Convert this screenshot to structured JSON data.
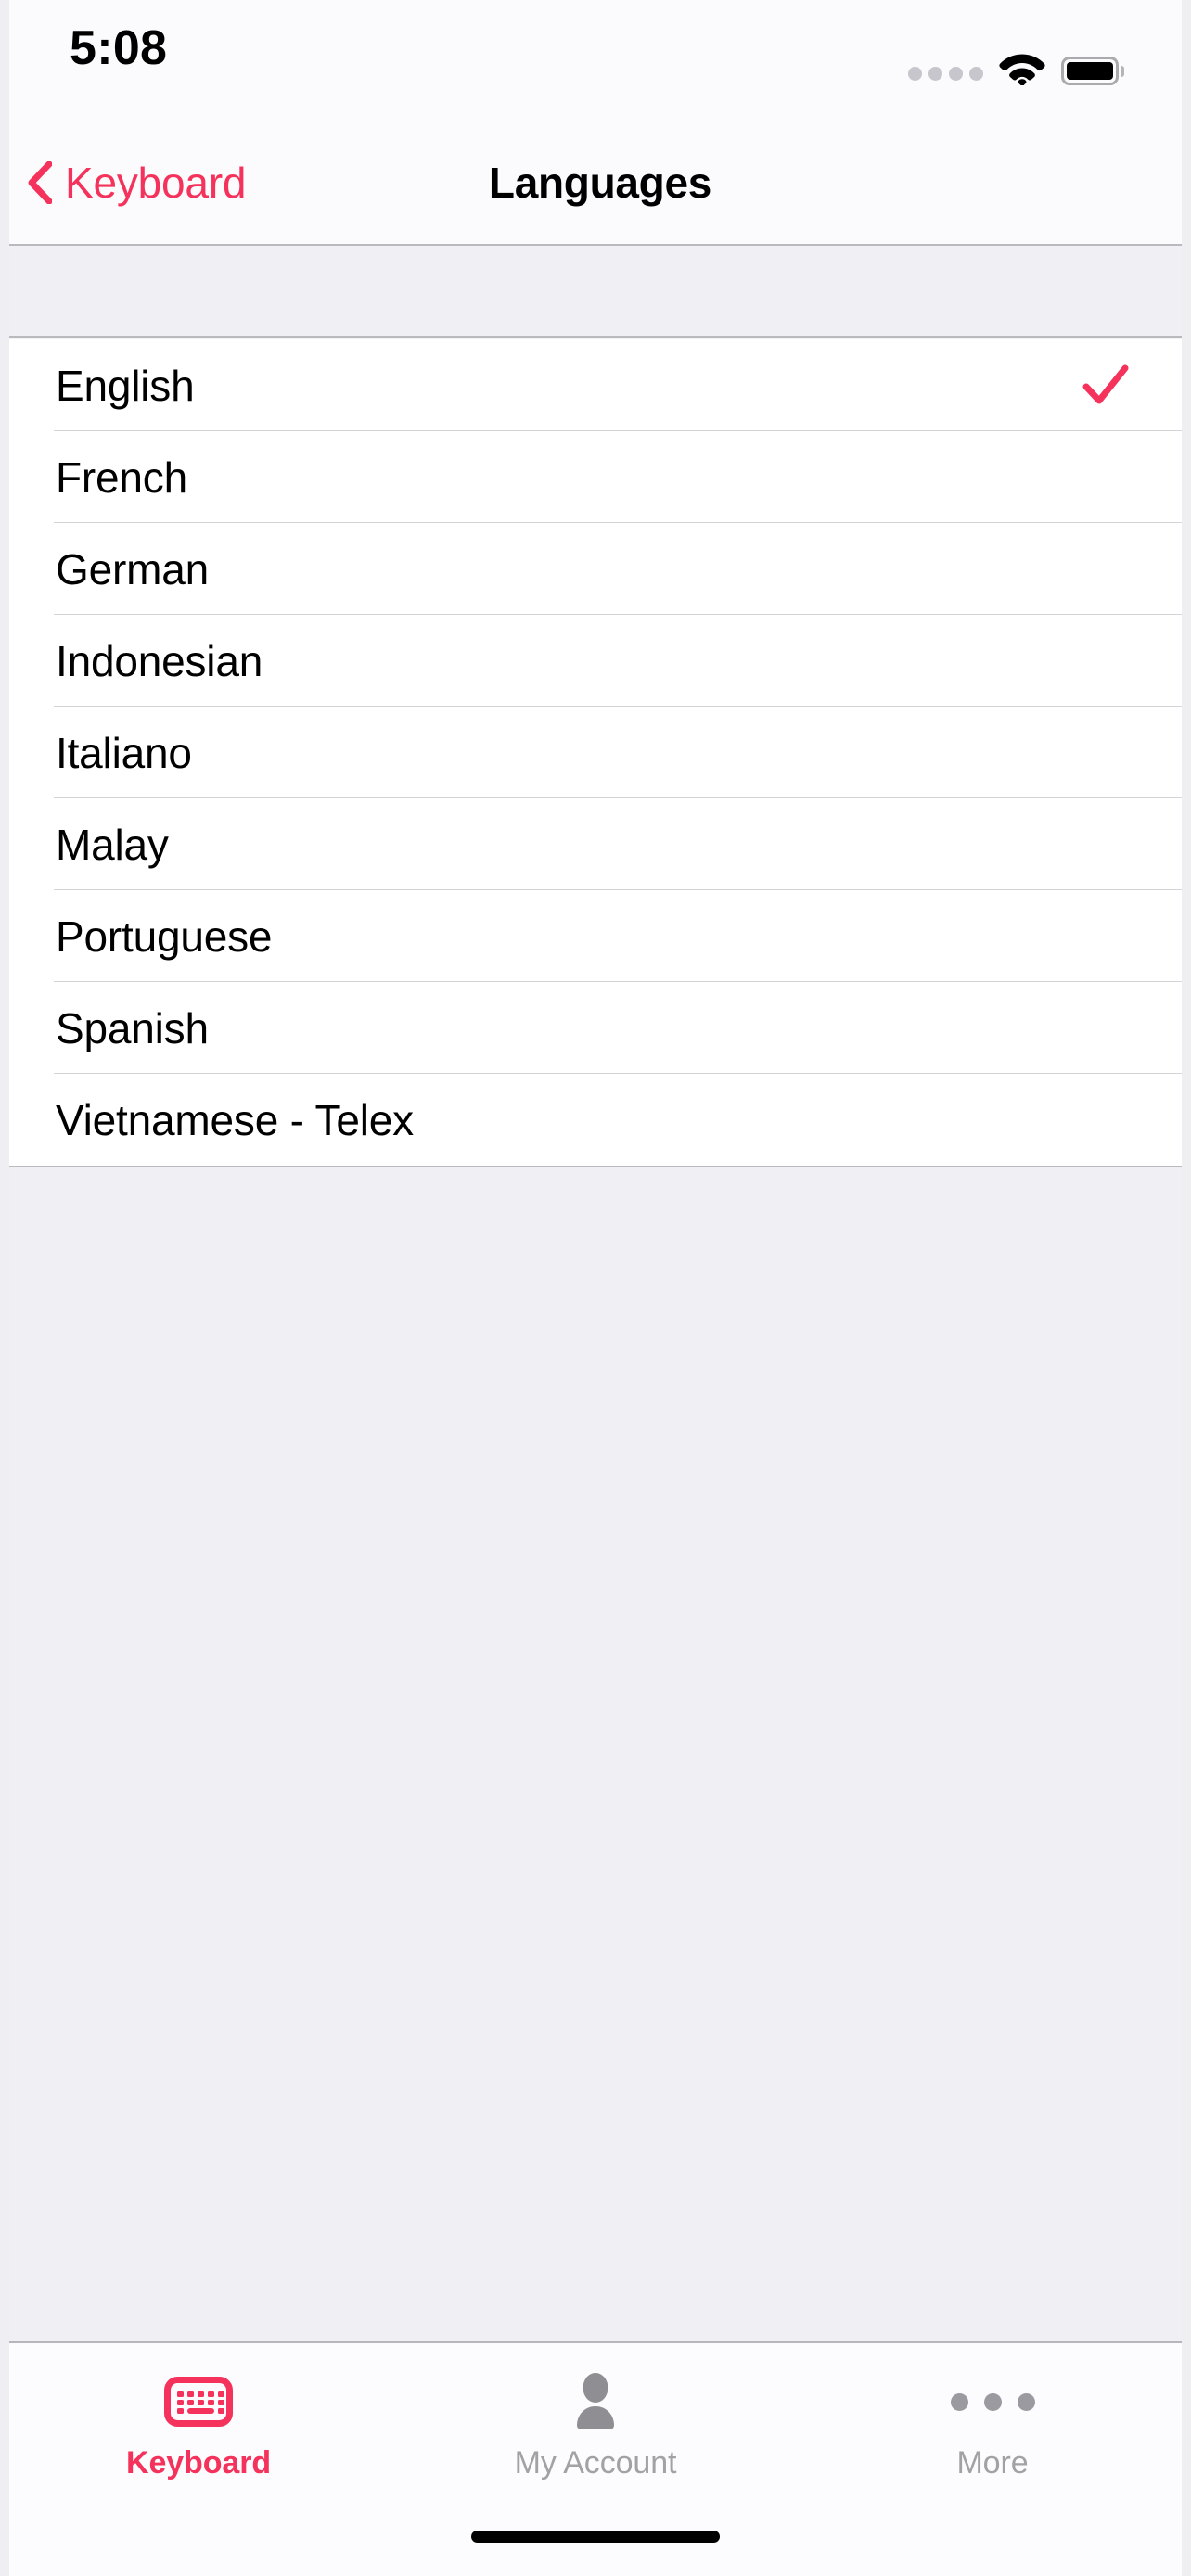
{
  "theme": {
    "accent": "#F4325B",
    "page_bg": "#F0EFF4",
    "card_bg": "#FFFFFF",
    "separator": "#D4D4D6",
    "inactive_tab": "#A1A1A6"
  },
  "status_bar": {
    "time": "5:08",
    "signal_icon": "cellular-dots-icon",
    "wifi_icon": "wifi-icon",
    "battery_icon": "battery-full-icon"
  },
  "nav_bar": {
    "back_icon": "chevron-left-icon",
    "back_label": "Keyboard",
    "title": "Languages"
  },
  "language_list": {
    "rows": [
      {
        "label": "English",
        "selected": true
      },
      {
        "label": "French",
        "selected": false
      },
      {
        "label": "German",
        "selected": false
      },
      {
        "label": "Indonesian",
        "selected": false
      },
      {
        "label": "Italiano",
        "selected": false
      },
      {
        "label": "Malay",
        "selected": false
      },
      {
        "label": "Portuguese",
        "selected": false
      },
      {
        "label": "Spanish",
        "selected": false
      },
      {
        "label": "Vietnamese - Telex",
        "selected": false
      }
    ],
    "selected_icon": "checkmark-icon"
  },
  "tab_bar": {
    "tabs": [
      {
        "label": "Keyboard",
        "icon": "keyboard-icon",
        "active": true
      },
      {
        "label": "My Account",
        "icon": "person-icon",
        "active": false
      },
      {
        "label": "More",
        "icon": "ellipsis-icon",
        "active": false
      }
    ]
  },
  "home_indicator": "home-indicator"
}
